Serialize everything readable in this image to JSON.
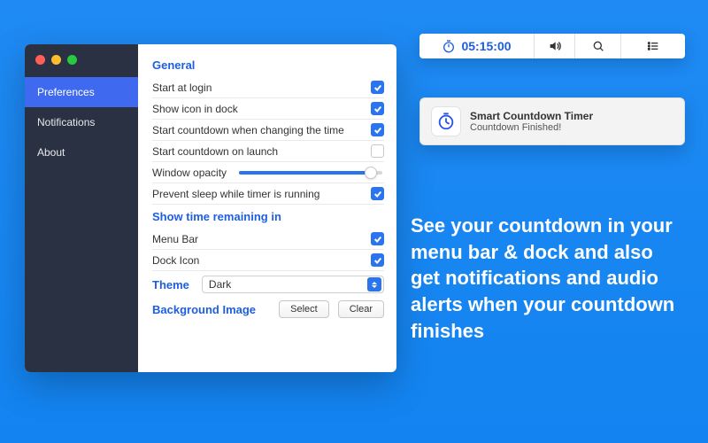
{
  "sidebar": {
    "items": [
      {
        "label": "Preferences",
        "selected": true
      },
      {
        "label": "Notifications",
        "selected": false
      },
      {
        "label": "About",
        "selected": false
      }
    ]
  },
  "sections": {
    "general": {
      "header": "General",
      "rows": {
        "start_at_login": {
          "label": "Start at login",
          "checked": true
        },
        "show_icon_dock": {
          "label": "Show icon in dock",
          "checked": true
        },
        "start_on_time_change": {
          "label": "Start countdown when changing the time",
          "checked": true
        },
        "start_on_launch": {
          "label": "Start countdown on launch",
          "checked": false
        },
        "window_opacity": {
          "label": "Window opacity",
          "value_pct": 92
        },
        "prevent_sleep": {
          "label": "Prevent sleep while timer is running",
          "checked": true
        }
      }
    },
    "show_remaining": {
      "header": "Show time remaining in",
      "rows": {
        "menu_bar": {
          "label": "Menu Bar",
          "checked": true
        },
        "dock_icon": {
          "label": "Dock Icon",
          "checked": true
        }
      }
    },
    "theme": {
      "header": "Theme",
      "selected": "Dark"
    },
    "background_image": {
      "header": "Background Image",
      "buttons": {
        "select": "Select",
        "clear": "Clear"
      }
    }
  },
  "menubar": {
    "timer_text": "05:15:00"
  },
  "notification": {
    "title": "Smart Countdown Timer",
    "subtitle": "Countdown Finished!"
  },
  "promo": {
    "text": "See your countdown in your menu bar & dock and also get notifications and audio alerts when your countdown finishes"
  },
  "colors": {
    "accent": "#2b74f0",
    "sidebar_bg": "#2a3142"
  }
}
